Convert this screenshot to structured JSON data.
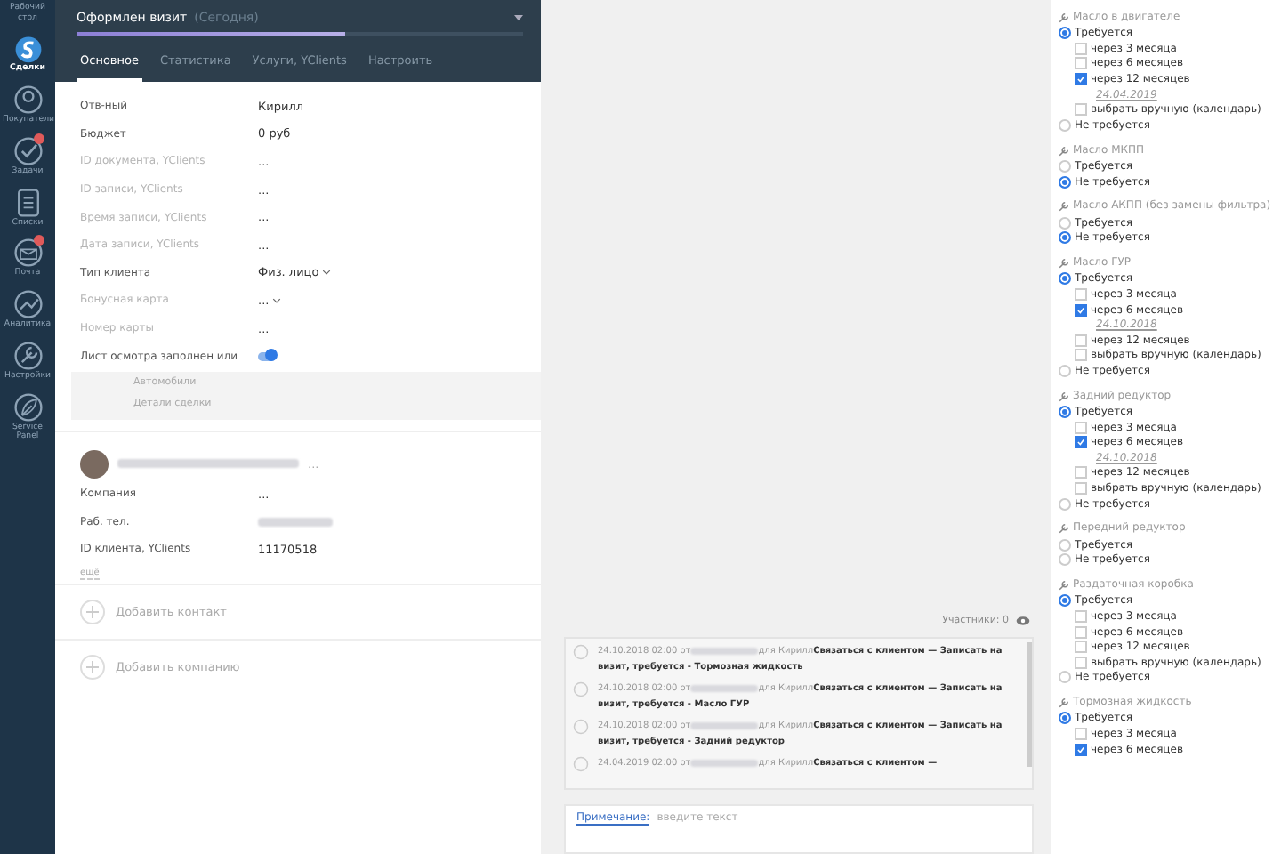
{
  "sidebar": {
    "items": [
      {
        "label": "Рабочий стол",
        "selected": false,
        "badge": false
      },
      {
        "label": "Сделки",
        "selected": true,
        "badge": false
      },
      {
        "label": "Покупатели",
        "selected": false,
        "badge": false
      },
      {
        "label": "Задачи",
        "selected": false,
        "badge": true
      },
      {
        "label": "Списки",
        "selected": false,
        "badge": false
      },
      {
        "label": "Почта",
        "selected": false,
        "badge": true
      },
      {
        "label": "Аналитика",
        "selected": false,
        "badge": false
      },
      {
        "label": "Настройки",
        "selected": false,
        "badge": false
      },
      {
        "label": "Service Panel",
        "selected": false,
        "badge": false
      }
    ]
  },
  "deal": {
    "title": "Оформлен визит",
    "when": "(Сегодня)",
    "level": 0.6,
    "tabs": [
      {
        "label": "Основное",
        "selected": true
      },
      {
        "label": "Статистика",
        "selected": false
      },
      {
        "label": "Услуги, YClients",
        "selected": false
      },
      {
        "label": "Настроить",
        "selected": false
      }
    ],
    "fields": [
      {
        "label": "Отв-ный",
        "value": "Кирилл",
        "kind": "text",
        "dim": false
      },
      {
        "label": "Бюджет",
        "value": "0 руб",
        "kind": "text",
        "dim": false
      },
      {
        "label": "ID документа, YClients",
        "value": "...",
        "kind": "text",
        "dim": true
      },
      {
        "label": "ID записи, YClients",
        "value": "...",
        "kind": "text",
        "dim": true
      },
      {
        "label": "Время записи, YClients",
        "value": "...",
        "kind": "text",
        "dim": true
      },
      {
        "label": "Дата записи, YClients",
        "value": "...",
        "kind": "text",
        "dim": true
      },
      {
        "label": "Тип клиента",
        "value": "Физ. лицо",
        "kind": "select",
        "dim": false
      },
      {
        "label": "Бонусная карта",
        "value": "...",
        "kind": "select",
        "dim": true
      },
      {
        "label": "Номер карты",
        "value": "...",
        "kind": "text",
        "dim": true
      },
      {
        "label": "Лист осмотра заполнен или",
        "kind": "toggle",
        "on": true,
        "dim": false
      }
    ],
    "groups": [
      "Автомобили",
      "Детали сделки"
    ],
    "contact": {
      "more": "...",
      "fields": [
        {
          "label": "Компания",
          "value": "...",
          "kind": "text"
        },
        {
          "label": "Раб. тел.",
          "kind": "redacted"
        },
        {
          "label": "ID клиента, YClients",
          "value": "11170518",
          "kind": "text"
        }
      ],
      "more_link": "ещё"
    },
    "add_buttons": [
      "Добавить контакт",
      "Добавить компанию"
    ]
  },
  "feed": {
    "participants": "Участники: 0",
    "entries": [
      {
        "time": "24.10.2018 02:00",
        "from": "от",
        "to": "для Кирилл",
        "text": "Связаться с клиентом — Записать на визит, требуется - Тормозная жидкость"
      },
      {
        "time": "24.10.2018 02:00",
        "from": "от",
        "to": "для Кирилл",
        "text": "Связаться с клиентом — Записать на визит, требуется - Масло ГУР"
      },
      {
        "time": "24.10.2018 02:00",
        "from": "от",
        "to": "для Кирилл",
        "text": "Связаться с клиентом — Записать на визит, требуется - Задний редуктор"
      },
      {
        "time": "24.04.2019 02:00",
        "from": "от",
        "to": "для Кирилл",
        "text": "Связаться с клиентом —"
      }
    ],
    "note": {
      "label": "Примечание:",
      "placeholder": "введите текст"
    }
  },
  "services": [
    {
      "title": "Масло в двигателе",
      "items": [
        {
          "kind": "radio",
          "label": "Требуется",
          "selected": true
        },
        {
          "kind": "check",
          "label": "через 3 месяца",
          "checked": false
        },
        {
          "kind": "check",
          "label": "через 6 месяцев",
          "checked": false
        },
        {
          "kind": "check",
          "label": "через 12 месяцев",
          "checked": true
        },
        {
          "kind": "date",
          "label": "24.04.2019"
        },
        {
          "kind": "check",
          "label": "выбрать вручную (календарь)",
          "checked": false
        },
        {
          "kind": "radio",
          "label": "Не требуется",
          "selected": false
        }
      ]
    },
    {
      "title": "Масло МКПП",
      "items": [
        {
          "kind": "radio",
          "label": "Требуется",
          "selected": false
        },
        {
          "kind": "radio",
          "label": "Не требуется",
          "selected": true
        }
      ]
    },
    {
      "title": "Масло АКПП (без замены фильтра)",
      "items": [
        {
          "kind": "radio",
          "label": "Требуется",
          "selected": false
        },
        {
          "kind": "radio",
          "label": "Не требуется",
          "selected": true
        }
      ]
    },
    {
      "title": "Масло ГУР",
      "items": [
        {
          "kind": "radio",
          "label": "Требуется",
          "selected": true
        },
        {
          "kind": "check",
          "label": "через 3 месяца",
          "checked": false
        },
        {
          "kind": "check",
          "label": "через 6 месяцев",
          "checked": true
        },
        {
          "kind": "date",
          "label": "24.10.2018"
        },
        {
          "kind": "check",
          "label": "через 12 месяцев",
          "checked": false
        },
        {
          "kind": "check",
          "label": "выбрать вручную (календарь)",
          "checked": false
        },
        {
          "kind": "radio",
          "label": "Не требуется",
          "selected": false
        }
      ]
    },
    {
      "title": "Задний редуктор",
      "items": [
        {
          "kind": "radio",
          "label": "Требуется",
          "selected": true
        },
        {
          "kind": "check",
          "label": "через 3 месяца",
          "checked": false
        },
        {
          "kind": "check",
          "label": "через 6 месяцев",
          "checked": true
        },
        {
          "kind": "date",
          "label": "24.10.2018"
        },
        {
          "kind": "check",
          "label": "через 12 месяцев",
          "checked": false
        },
        {
          "kind": "check",
          "label": "выбрать вручную (календарь)",
          "checked": false
        },
        {
          "kind": "radio",
          "label": "Не требуется",
          "selected": false
        }
      ]
    },
    {
      "title": "Передний редуктор",
      "items": [
        {
          "kind": "radio",
          "label": "Требуется",
          "selected": false
        },
        {
          "kind": "radio",
          "label": "Не требуется",
          "selected": false
        }
      ]
    },
    {
      "title": "Раздаточная коробка",
      "items": [
        {
          "kind": "radio",
          "label": "Требуется",
          "selected": true
        },
        {
          "kind": "check",
          "label": "через 3 месяца",
          "checked": false
        },
        {
          "kind": "check",
          "label": "через 6 месяцев",
          "checked": false
        },
        {
          "kind": "check",
          "label": "через 12 месяцев",
          "checked": false
        },
        {
          "kind": "check",
          "label": "выбрать вручную (календарь)",
          "checked": false
        },
        {
          "kind": "radio",
          "label": "Не требуется",
          "selected": false
        }
      ]
    },
    {
      "title": "Тормозная жидкость",
      "items": [
        {
          "kind": "radio",
          "label": "Требуется",
          "selected": true
        },
        {
          "kind": "check",
          "label": "через 3 месяца",
          "checked": false
        },
        {
          "kind": "check",
          "label": "через 6 месяцев",
          "checked": true
        }
      ]
    }
  ]
}
